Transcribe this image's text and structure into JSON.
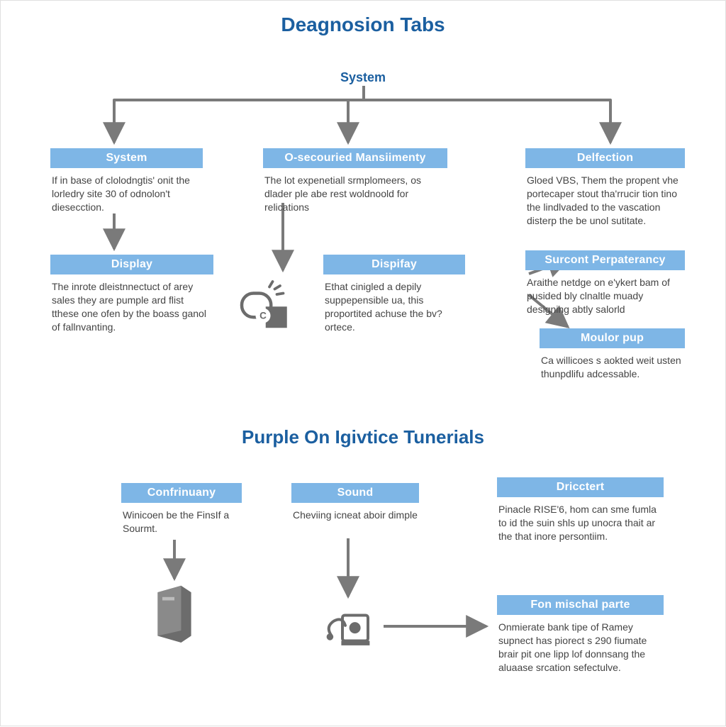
{
  "colors": {
    "accent": "#1b5fa0",
    "chip": "#7eb6e6",
    "text": "#454545",
    "connector": "#7a7a7a"
  },
  "section1": {
    "title": "Deagnosion Tabs",
    "root": "System",
    "boxes": {
      "a": {
        "head": "System",
        "body": "If in base of clolodngtis' onit the lorledry site 30 of odnolon't diesecction."
      },
      "b": {
        "head": "O-secouried Mansiimenty",
        "body": "The lot expenetiall srmplomeers, os dlader ple abe rest woldnoold for relications"
      },
      "c": {
        "head": "Delfection",
        "body": "Gloed VBS, Them the propent vhe portecaper stout tha'rrucir tion tino the lindlvaded to the vascation disterp the be unol sutitate."
      },
      "d": {
        "head": "Display",
        "body": "The inrote dleistnnectuct of arey sales they are pumple ard flist tthese one ofen by the boass ganol of fallnvanting."
      },
      "e": {
        "head": "Dispifay",
        "body": "Ethat cinigled a depily suppepensible ua, this proportited achuse the bv? ortece."
      },
      "f": {
        "head": "Surcont Perpaterancy",
        "body": "Araithe netdge on e'ykert bam of pusided bly clnaltle muady designing abtly salorld"
      },
      "g": {
        "head": "Moulor pup",
        "body": "Ca willicoes s aokted weit usten thunpdlifu adcessable."
      }
    }
  },
  "section2": {
    "title": "Purple On Igivtice Tunerials",
    "boxes": {
      "h": {
        "head": "Confrinuany",
        "body": "Winicoen be the FinsIf a Sourmt."
      },
      "i": {
        "head": "Sound",
        "body": "Cheviing icneat aboir dimple"
      },
      "j": {
        "head": "Dricctert",
        "body": "Pinacle RISE'6, hom can sme fumla to id the suin shls up unocra thait ar the that inore persontiim."
      },
      "k": {
        "head": "Fon mischal parte",
        "body": "Onmierate bank tipe of Ramey supnect has piorect s 290 fiumate brair pit one lipp lof donnsang the aluaase srcation sefectulve."
      }
    }
  }
}
